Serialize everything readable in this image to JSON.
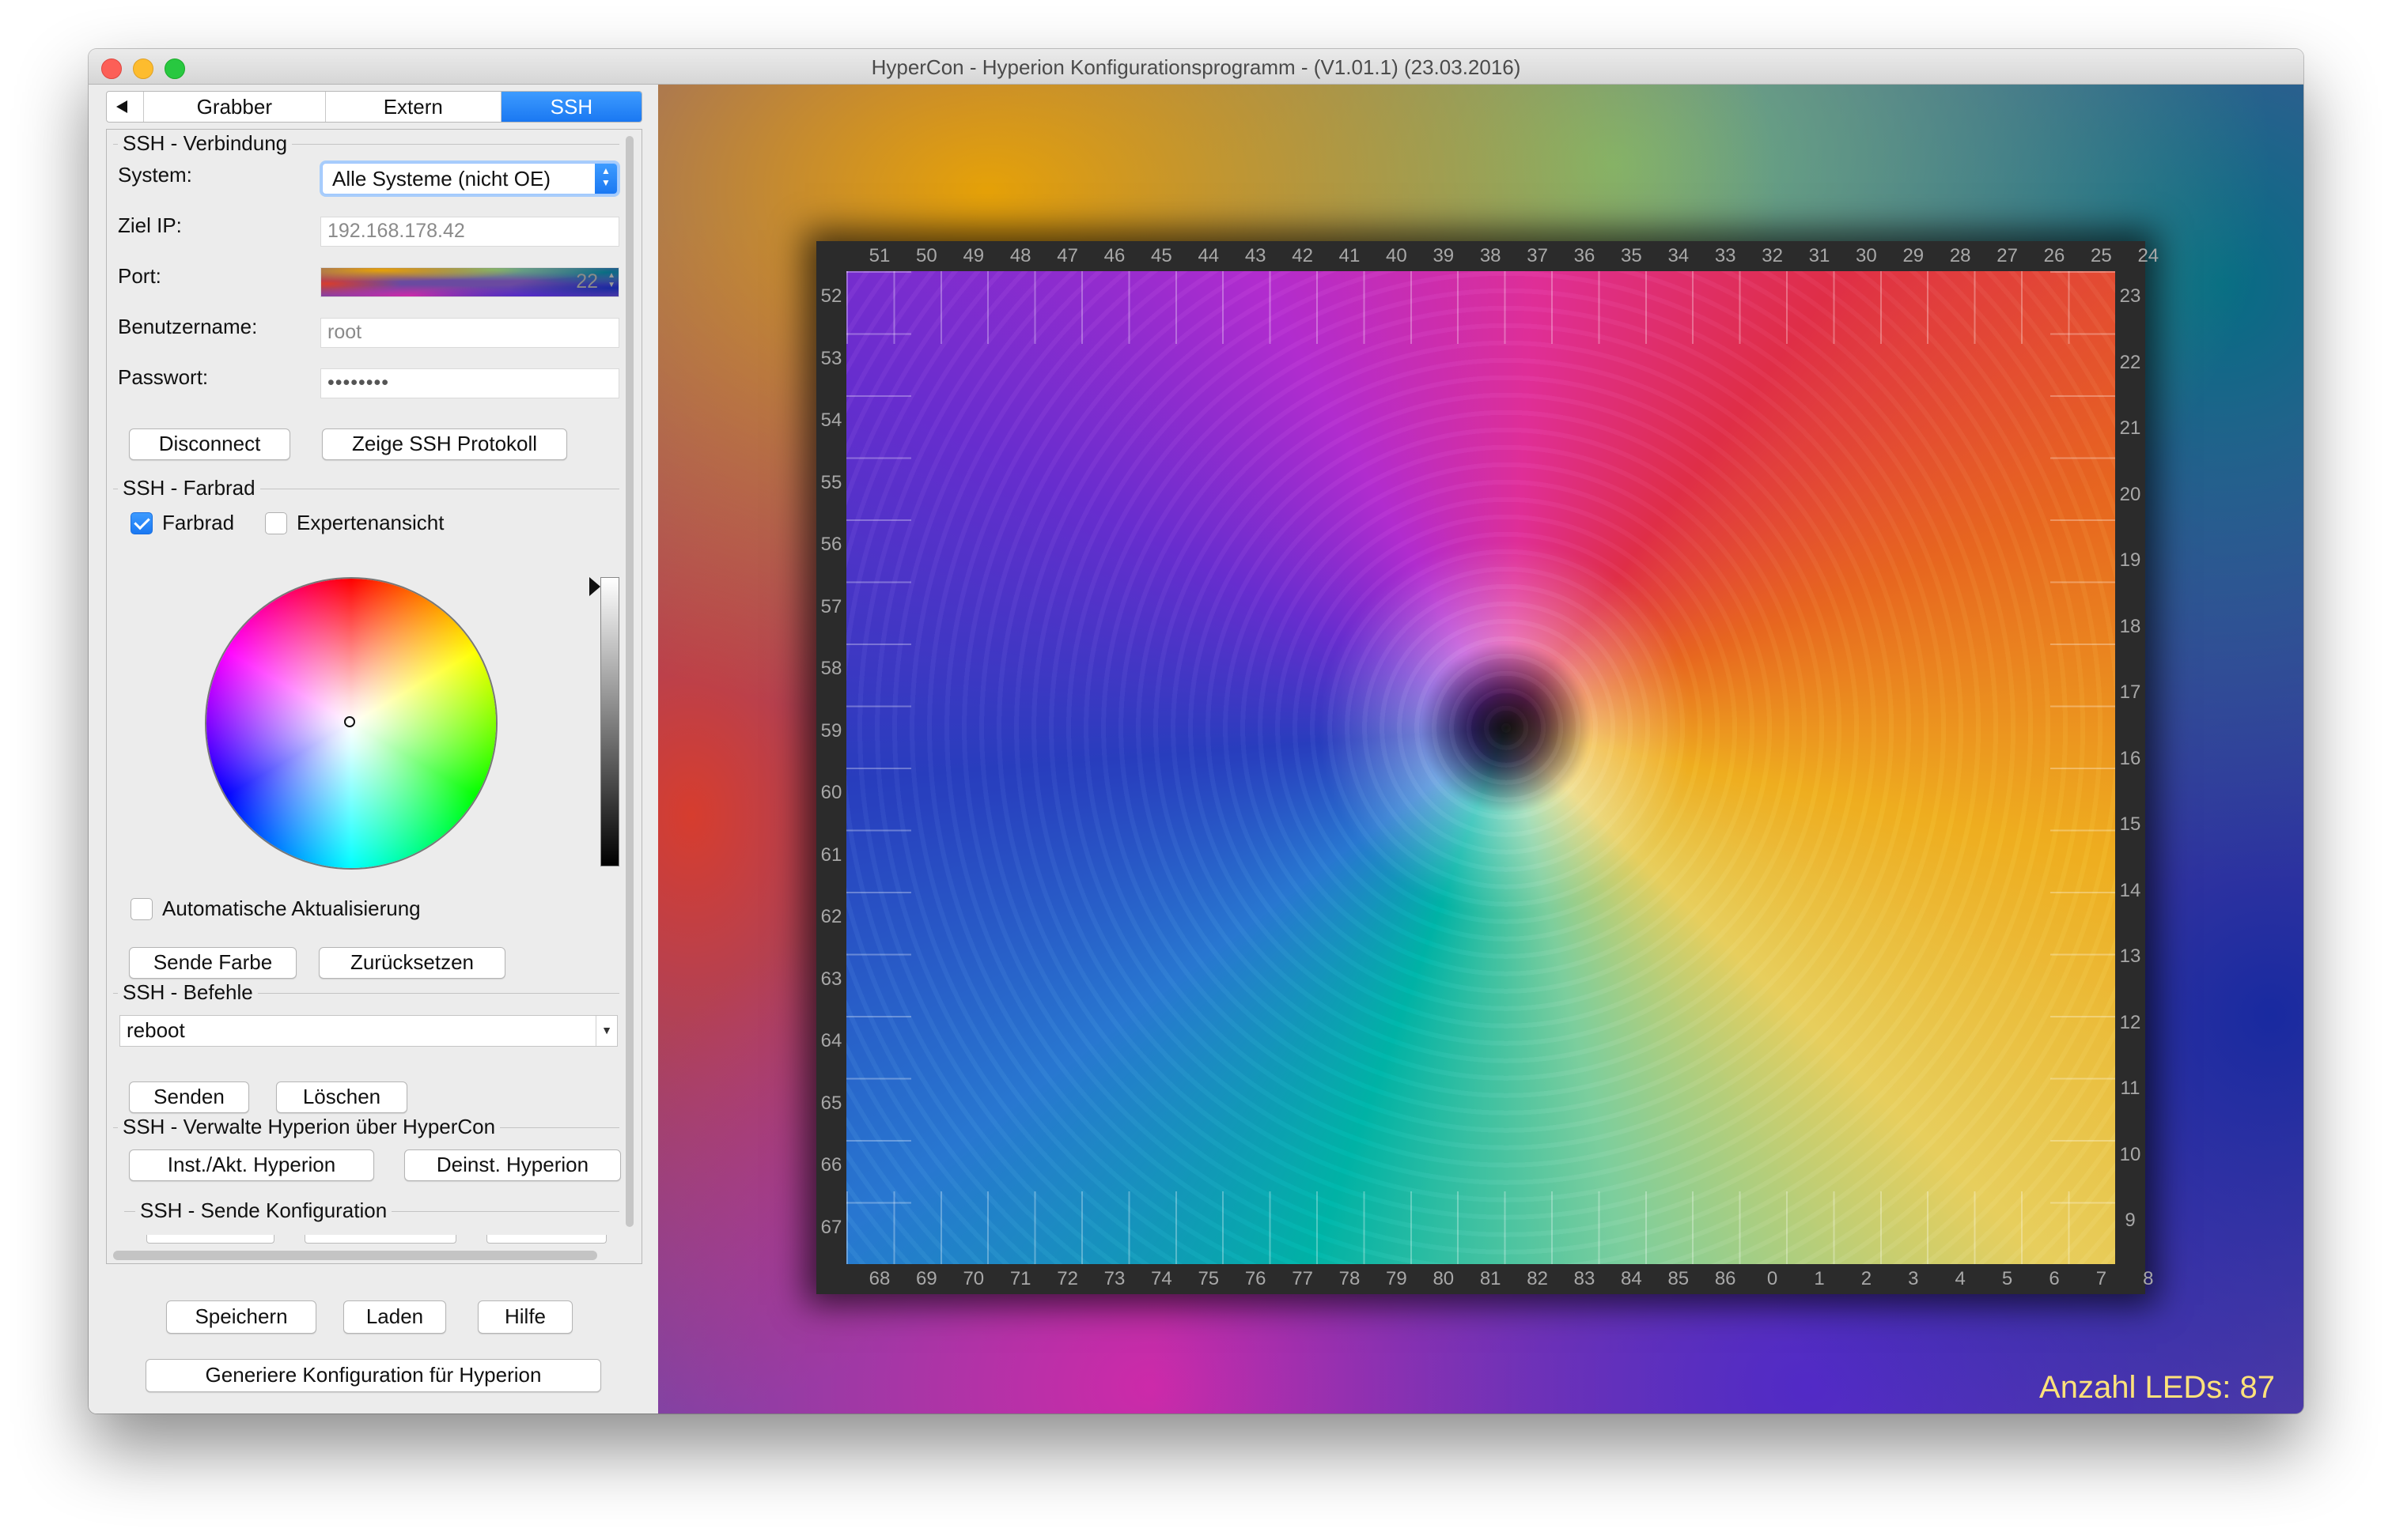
{
  "window": {
    "title": "HyperCon - Hyperion Konfigurationsprogramm - (V1.01.1) (23.03.2016)"
  },
  "tabs": [
    {
      "label": "Grabber",
      "active": false
    },
    {
      "label": "Extern",
      "active": false
    },
    {
      "label": "SSH",
      "active": true
    }
  ],
  "connection": {
    "title": "SSH - Verbindung",
    "system_label": "System:",
    "system_value": "Alle Systeme (nicht OE)",
    "ip_label": "Ziel IP:",
    "ip_value": "192.168.178.42",
    "port_label": "Port:",
    "port_value": "22",
    "user_label": "Benutzername:",
    "user_value": "root",
    "password_label": "Passwort:",
    "password_value": "••••••••",
    "disconnect": "Disconnect",
    "show_log": "Zeige SSH Protokoll"
  },
  "colorwheel": {
    "title": "SSH - Farbrad",
    "farbrad_label": "Farbrad",
    "farbrad_checked": true,
    "expert_label": "Expertenansicht",
    "expert_checked": false,
    "auto_update_label": "Automatische Aktualisierung",
    "auto_update_checked": false,
    "send_color": "Sende Farbe",
    "reset": "Zurücksetzen"
  },
  "commands": {
    "title": "SSH - Befehle",
    "command_value": "reboot",
    "send": "Senden",
    "delete": "Löschen"
  },
  "manage": {
    "title": "SSH - Verwalte Hyperion über HyperCon",
    "install": "Inst./Akt. Hyperion",
    "uninstall": "Deinst. Hyperion"
  },
  "send_config": {
    "title": "SSH - Sende Konfiguration"
  },
  "bottom": {
    "save": "Speichern",
    "load": "Laden",
    "help": "Hilfe",
    "generate": "Generiere Konfiguration für Hyperion"
  },
  "preview": {
    "top_leds": [
      "51",
      "50",
      "49",
      "48",
      "47",
      "46",
      "45",
      "44",
      "43",
      "42",
      "41",
      "40",
      "39",
      "38",
      "37",
      "36",
      "35",
      "34",
      "33",
      "32",
      "31",
      "30",
      "29",
      "28",
      "27",
      "26",
      "25",
      "24"
    ],
    "bottom_leds": [
      "68",
      "69",
      "70",
      "71",
      "72",
      "73",
      "74",
      "75",
      "76",
      "77",
      "78",
      "79",
      "80",
      "81",
      "82",
      "83",
      "84",
      "85",
      "86",
      "0",
      "1",
      "2",
      "3",
      "4",
      "5",
      "6",
      "7",
      "8"
    ],
    "left_leds": [
      "52",
      "53",
      "54",
      "55",
      "56",
      "57",
      "58",
      "59",
      "60",
      "61",
      "62",
      "63",
      "64",
      "65",
      "66",
      "67"
    ],
    "right_leds": [
      "23",
      "22",
      "21",
      "20",
      "19",
      "18",
      "17",
      "16",
      "15",
      "14",
      "13",
      "12",
      "11",
      "10",
      "9"
    ],
    "led_count": "Anzahl LEDs: 87"
  }
}
